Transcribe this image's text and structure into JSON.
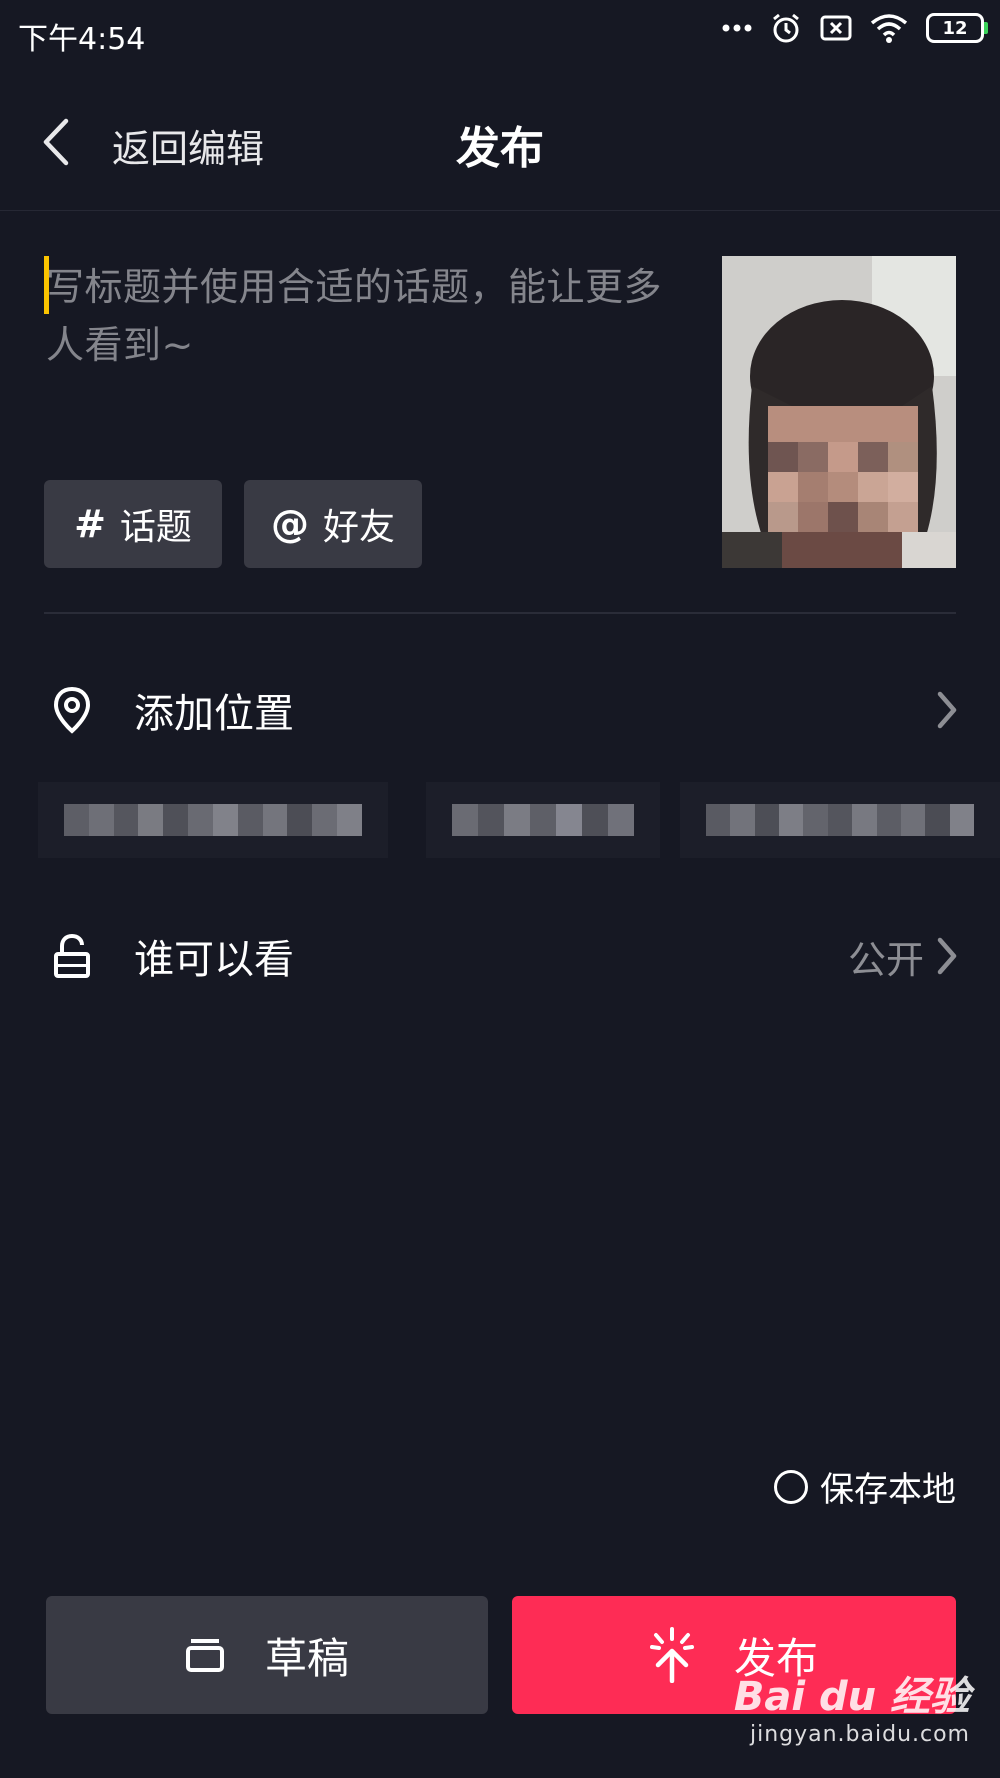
{
  "status_bar": {
    "time": "下午4:54",
    "battery": "12",
    "icons": [
      "more-dots-icon",
      "alarm-icon",
      "sim-x-icon",
      "wifi-icon",
      "battery-icon"
    ]
  },
  "header": {
    "back_label": "返回编辑",
    "title": "发布"
  },
  "caption": {
    "placeholder": "写标题并使用合适的话题，能让更多人看到~"
  },
  "chips": {
    "topic_symbol": "#",
    "topic_label": "话题",
    "friend_symbol": "@",
    "friend_label": "好友"
  },
  "location": {
    "label": "添加位置"
  },
  "privacy": {
    "label": "谁可以看",
    "value": "公开"
  },
  "save_local": {
    "label": "保存本地",
    "checked": false
  },
  "actions": {
    "draft_label": "草稿",
    "publish_label": "发布"
  },
  "watermark": {
    "brand": "Bai du 经验",
    "url": "jingyan.baidu.com"
  },
  "colors": {
    "background": "#161823",
    "chip": "#393a44",
    "accent": "#fe2c55",
    "caret": "#fbc400"
  }
}
